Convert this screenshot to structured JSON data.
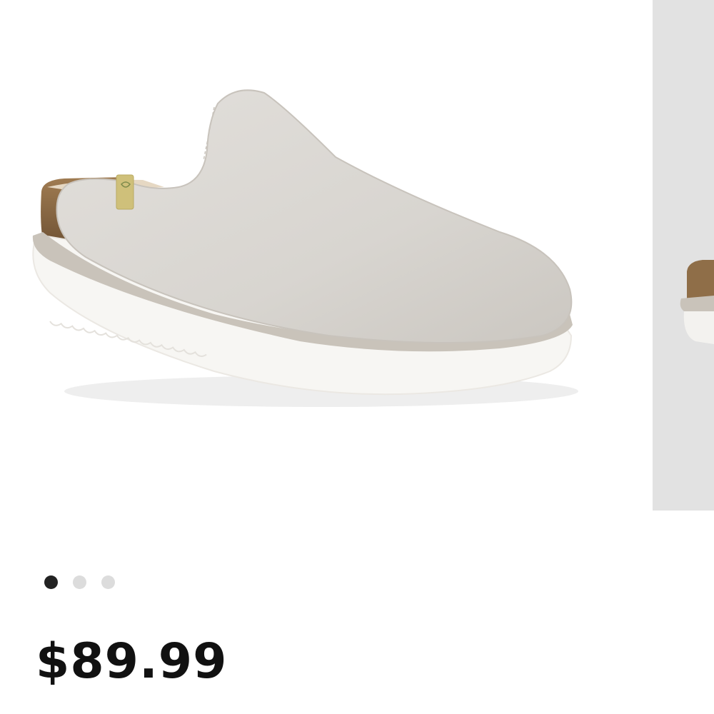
{
  "product": {
    "price": "$89.99",
    "image": {
      "name": "clog-shoe-photo",
      "colors": {
        "upper": "#d9d6d1",
        "binding": "#c7c1b8",
        "sole": "#f6f4f1",
        "cork": "#8a6a45",
        "tag": "#cfc07a"
      }
    }
  },
  "carousel": {
    "slides": 3,
    "active_index": 0,
    "next_slide_background": "#e2e2e2",
    "dots": [
      {
        "state": "active"
      },
      {
        "state": "inactive"
      },
      {
        "state": "inactive"
      }
    ],
    "dot_colors": {
      "active": "#222222",
      "inactive": "#dcdcdc"
    }
  }
}
